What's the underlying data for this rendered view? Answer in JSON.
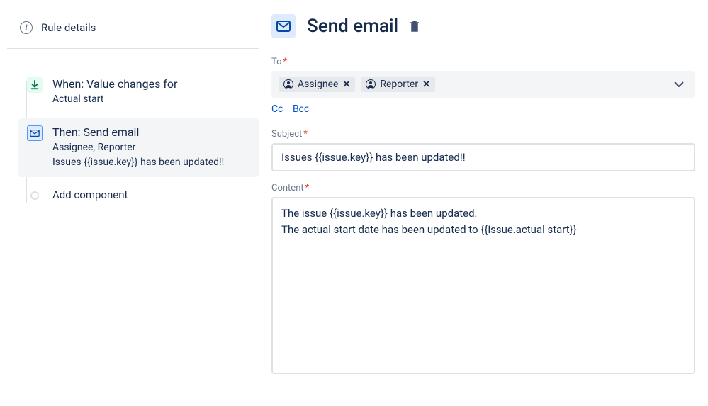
{
  "sidebar": {
    "rule_details": "Rule details",
    "trigger": {
      "title": "When: Value changes for",
      "sub": "Actual start"
    },
    "action": {
      "title": "Then: Send email",
      "sub1": "Assignee, Reporter",
      "sub2": "Issues {{issue.key}} has been updated!!"
    },
    "add_component": "Add component"
  },
  "main": {
    "title": "Send email",
    "to": {
      "label": "To",
      "chips": [
        "Assignee",
        "Reporter"
      ]
    },
    "cc": "Cc",
    "bcc": "Bcc",
    "subject": {
      "label": "Subject",
      "value": "Issues {{issue.key}} has been updated!!"
    },
    "content": {
      "label": "Content",
      "value": "The issue {{issue.key}} has been updated.\nThe actual start date has been updated to {{issue.actual start}}"
    }
  }
}
